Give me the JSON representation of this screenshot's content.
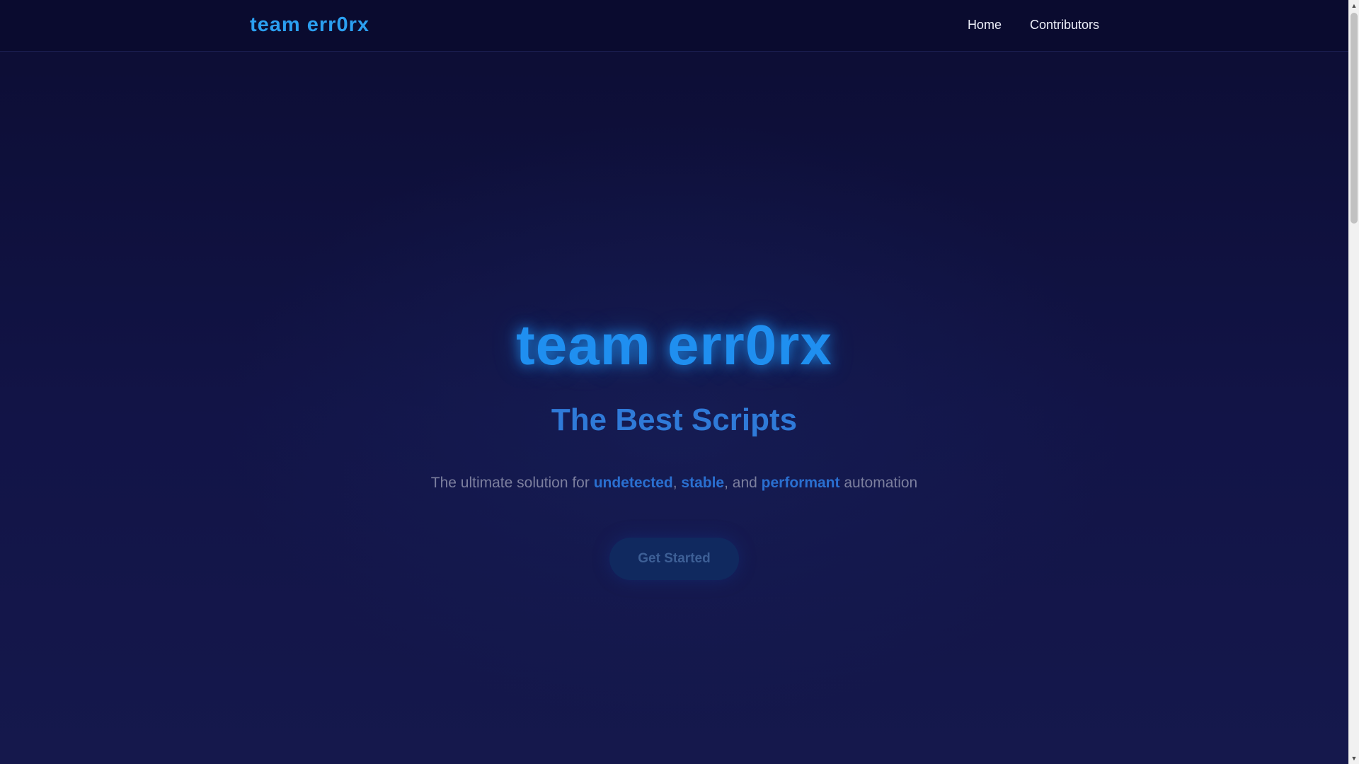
{
  "header": {
    "brand": "team err0rx",
    "nav": [
      {
        "label": "Home"
      },
      {
        "label": "Contributors"
      }
    ]
  },
  "hero": {
    "title": "team err0rx",
    "subtitle": "The Best Scripts",
    "tagline": {
      "prefix": "The ultimate solution for ",
      "highlight_1": "undetected",
      "sep_1": ", ",
      "highlight_2": "stable",
      "sep_2": ", and ",
      "highlight_3": "performant",
      "suffix": " automation"
    },
    "cta_label": "Get Started"
  },
  "colors": {
    "background": "#0f1035",
    "accent": "#1f8ff0",
    "subtitle": "#2f7ad8",
    "highlight": "#2a6fd0",
    "muted_text": "#7c7f9e",
    "button_bg": "#10295f"
  },
  "icons": {
    "scroll_up": "scroll-up-arrow-icon",
    "scroll_down": "scroll-down-arrow-icon"
  }
}
